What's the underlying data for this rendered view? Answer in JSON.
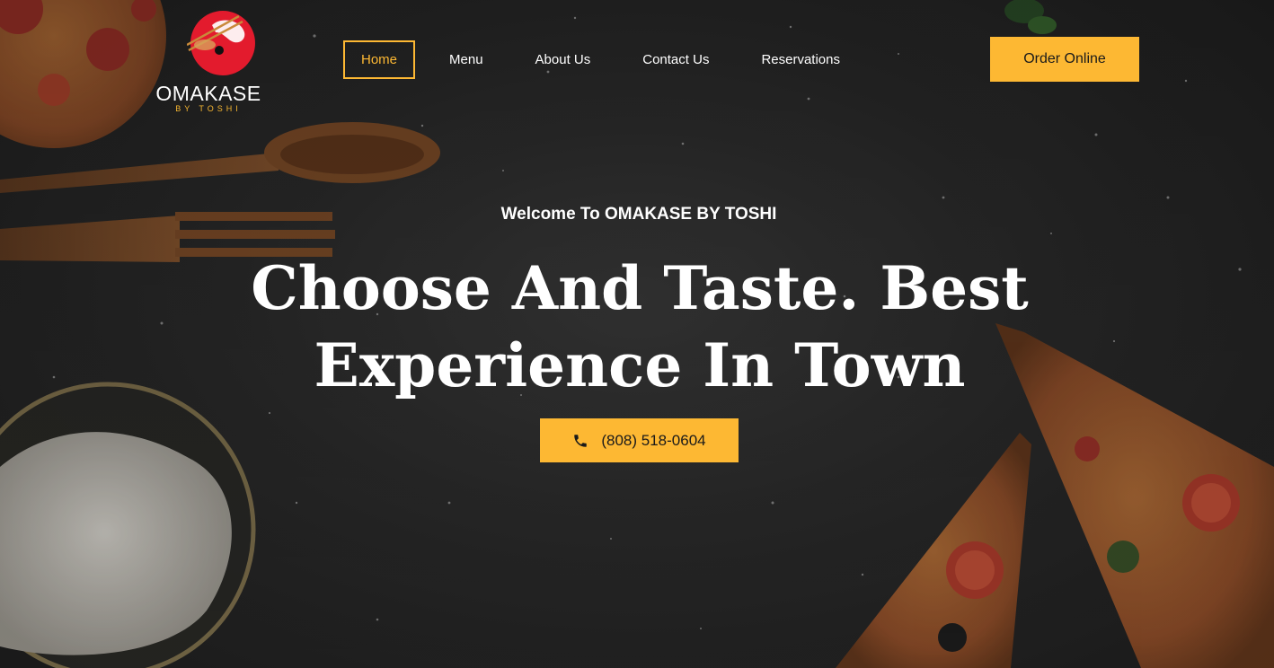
{
  "brand": {
    "name": "OMAKASE",
    "subtitle": "BY TOSHI",
    "logo_icon": "sushi-chopsticks-logo-icon",
    "accent_color": "#fdb833",
    "logo_red": "#e31b2d"
  },
  "nav": {
    "items": [
      {
        "label": "Home",
        "active": true
      },
      {
        "label": "Menu",
        "active": false
      },
      {
        "label": "About Us",
        "active": false
      },
      {
        "label": "Contact Us",
        "active": false
      },
      {
        "label": "Reservations",
        "active": false
      }
    ],
    "order_button": "Order Online"
  },
  "hero": {
    "welcome": "Welcome To OMAKASE BY TOSHI",
    "headline_line1": "Choose And Taste. Best",
    "headline_line2": "Experience In Town",
    "phone_icon": "phone-icon",
    "phone": "(808) 518-0604"
  }
}
